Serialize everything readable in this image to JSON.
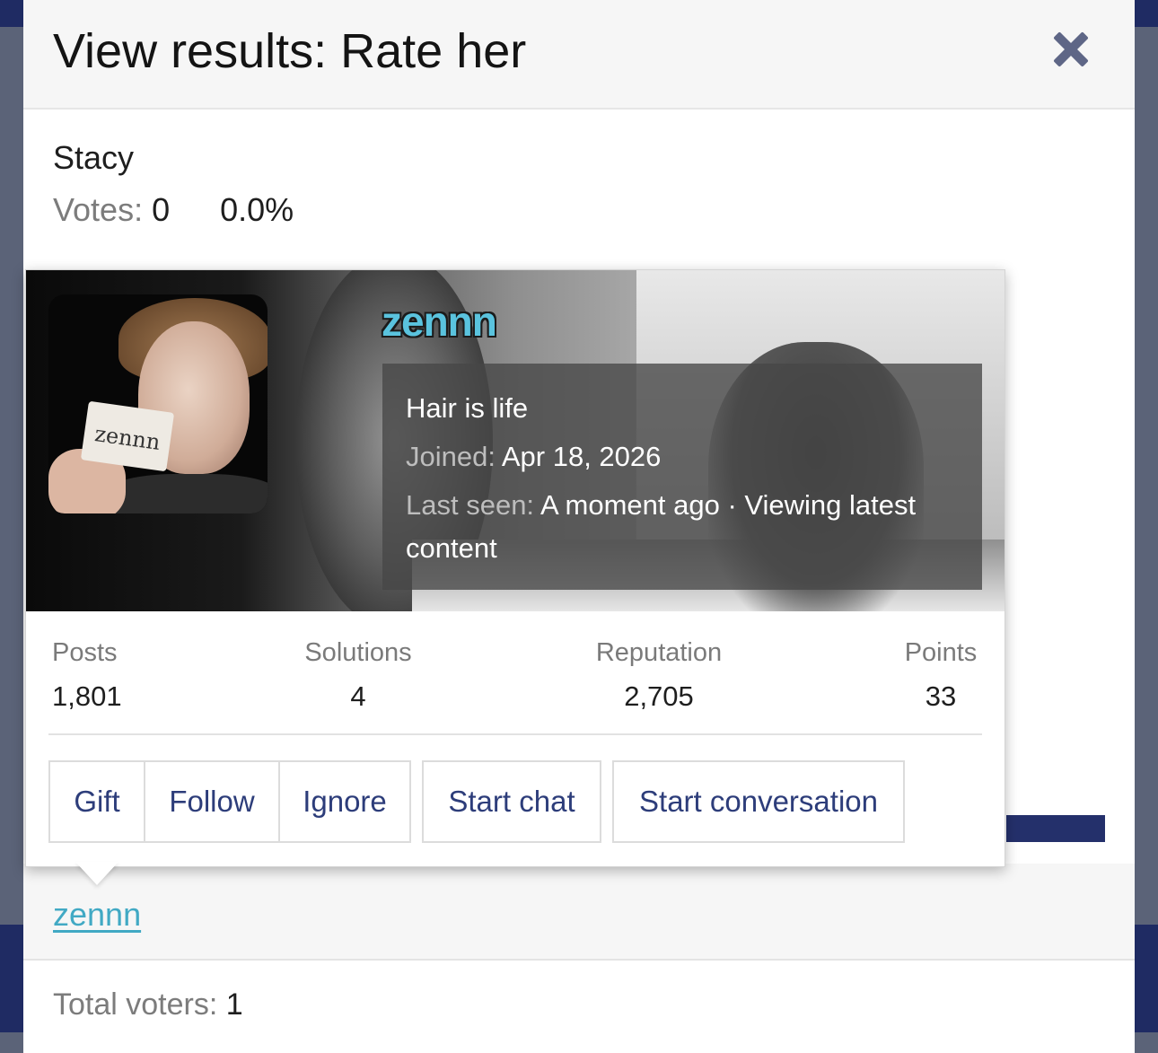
{
  "dialog": {
    "title": "View results: Rate her"
  },
  "poll": {
    "option_name": "Stacy",
    "votes_label": "Votes:",
    "votes_value": "0",
    "percent": "0.0%",
    "bar_accent": "#24306b"
  },
  "voters": {
    "voter_name": "zennn",
    "total_label": "Total voters:",
    "total_value": "1"
  },
  "member_card": {
    "username": "zennn",
    "avatar_caption": "zennn",
    "status": "Hair is life",
    "joined_label": "Joined:",
    "joined_value": "Apr 18, 2026",
    "last_seen_label": "Last seen:",
    "last_seen_value_1": "A moment ago · Viewing latest",
    "last_seen_value_2": "content",
    "stats": [
      {
        "label": "Posts",
        "value": "1,801"
      },
      {
        "label": "Solutions",
        "value": "4"
      },
      {
        "label": "Reputation",
        "value": "2,705"
      },
      {
        "label": "Points",
        "value": "33"
      }
    ],
    "actions": [
      "Gift",
      "Follow",
      "Ignore",
      "Start chat",
      "Start conversation"
    ]
  },
  "colors": {
    "username": "#5ac3de",
    "link": "#41a9c4",
    "button_text": "#2d3d7a",
    "close_icon": "#5e6686"
  }
}
